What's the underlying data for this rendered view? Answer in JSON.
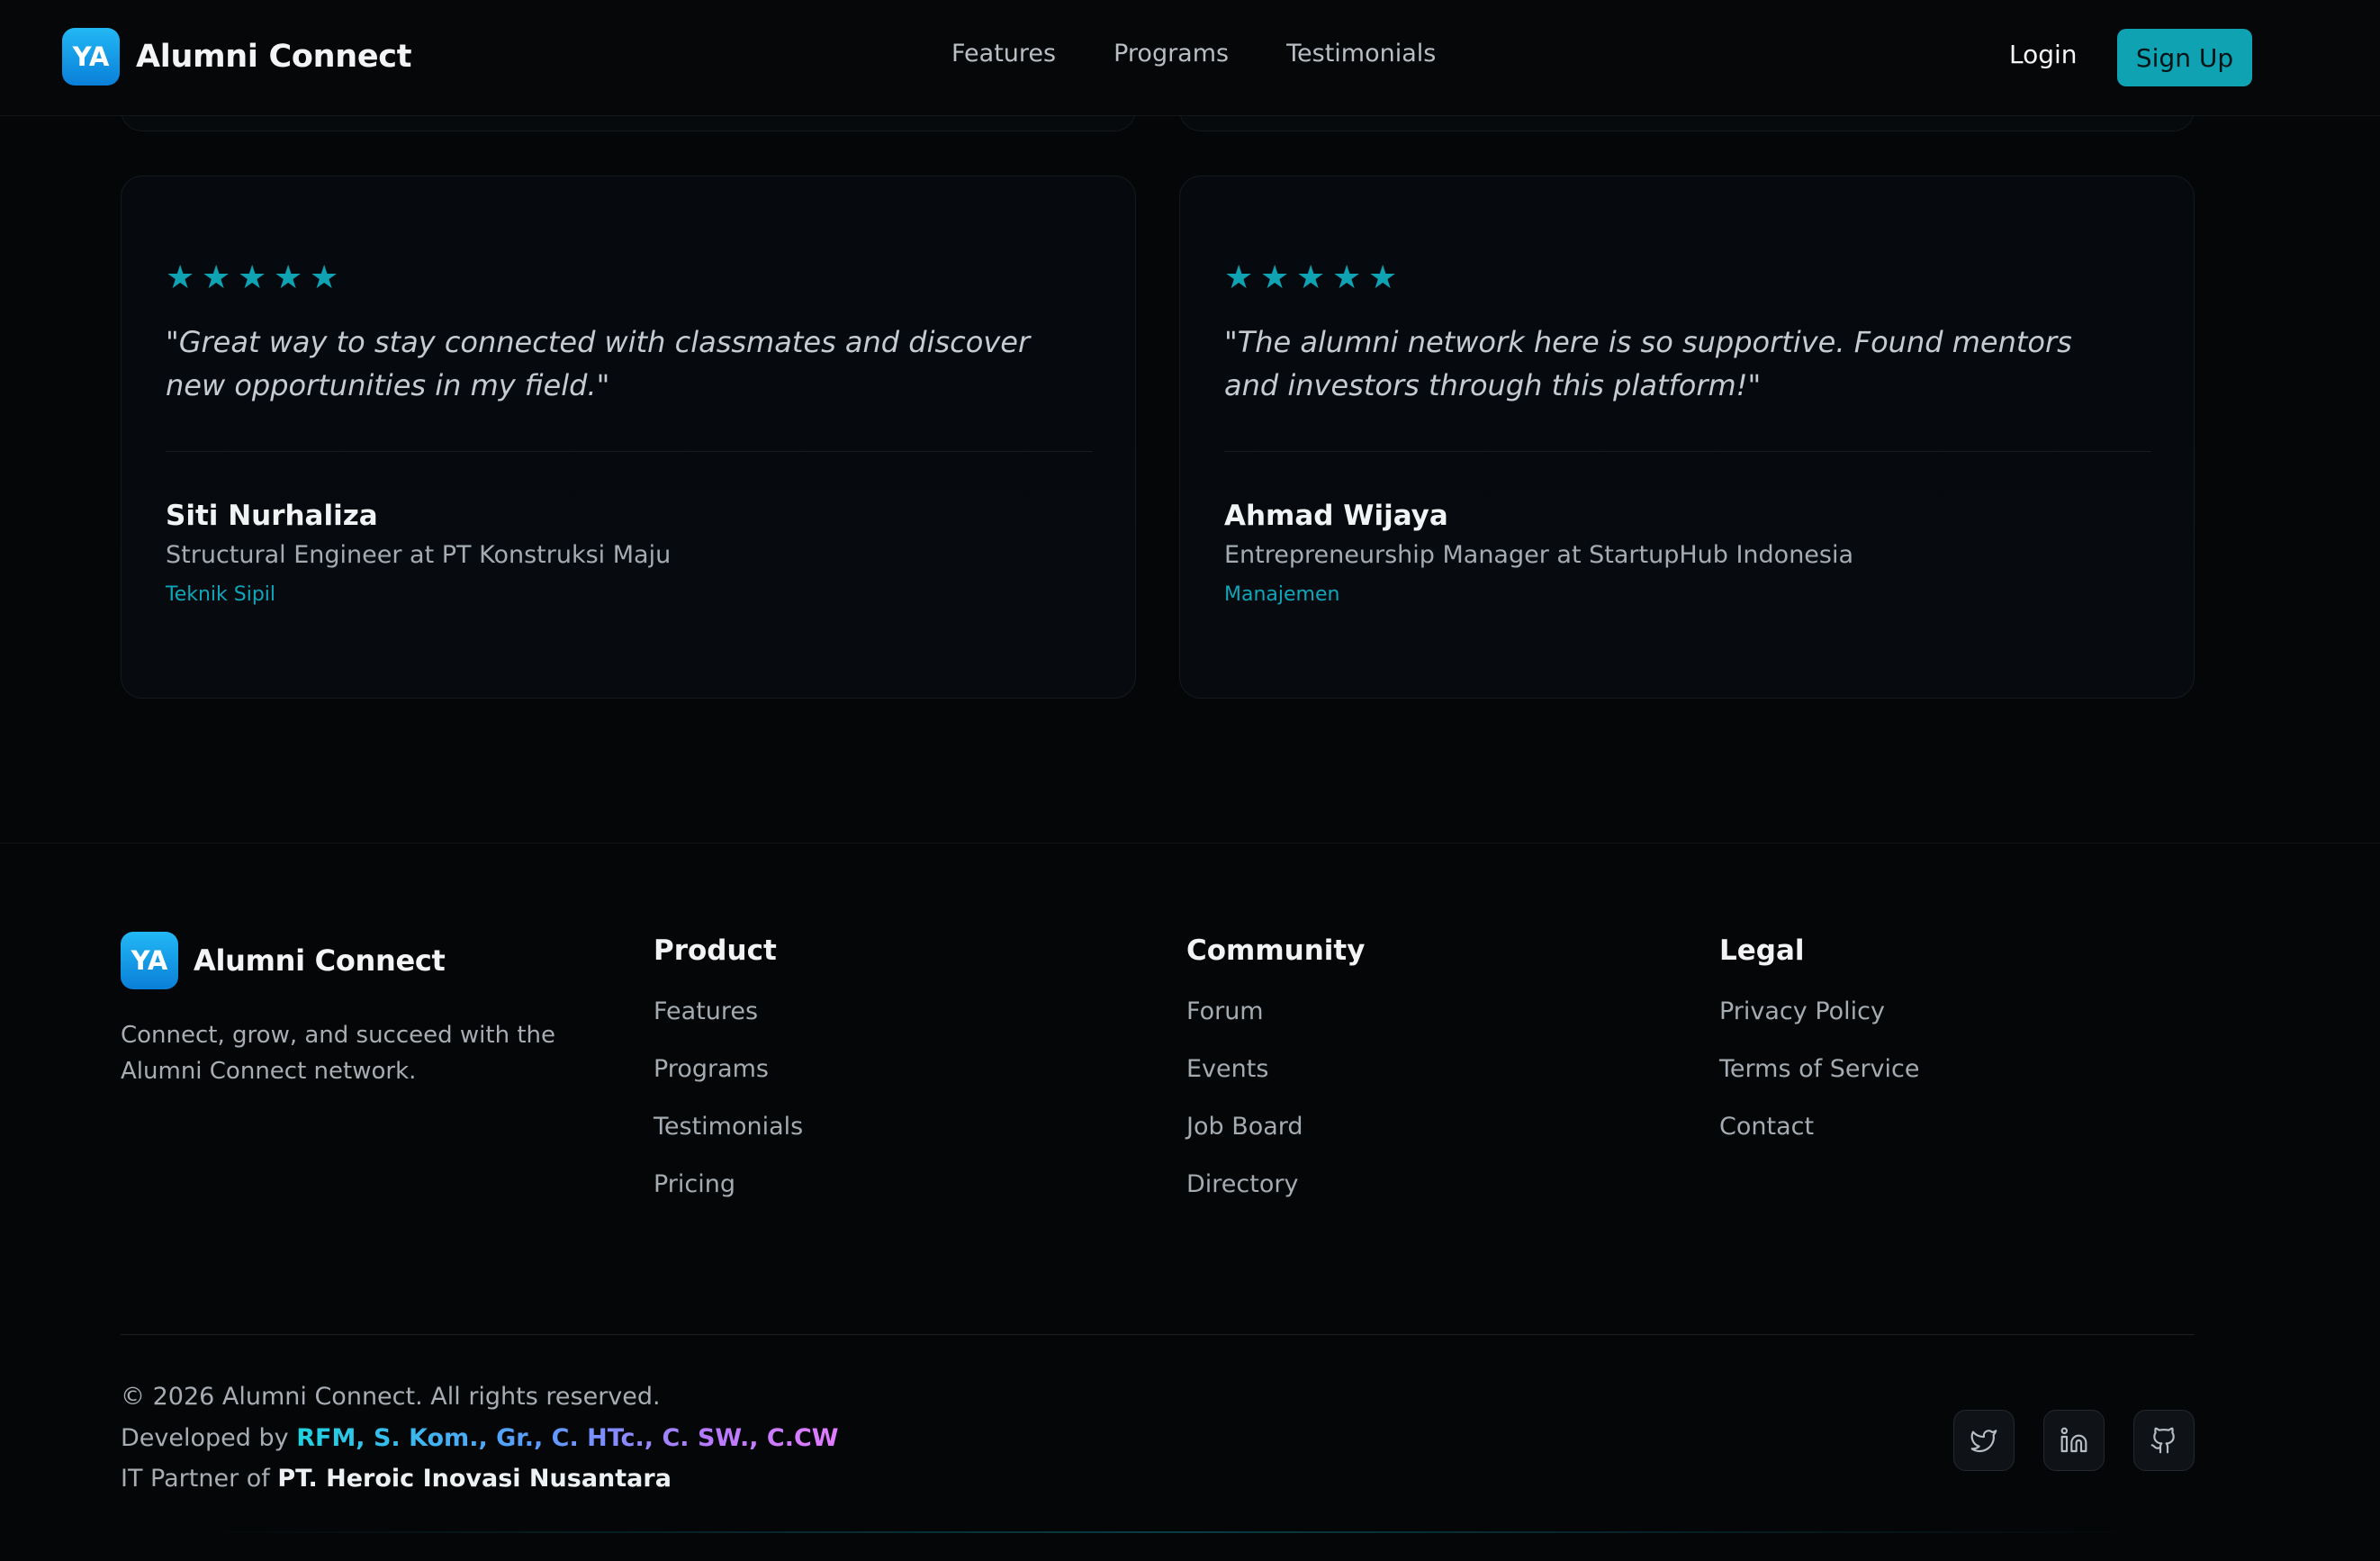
{
  "header": {
    "logo_initials": "YA",
    "brand_name": "Alumni Connect",
    "nav": [
      "Features",
      "Programs",
      "Testimonials"
    ],
    "login_label": "Login",
    "signup_label": "Sign Up"
  },
  "testimonials": [
    {
      "rating": 5,
      "quote": "\"Great way to stay connected with classmates and discover new opportunities in my field.\"",
      "name": "Siti Nurhaliza",
      "role": "Structural Engineer at PT Konstruksi Maju",
      "department": "Teknik Sipil"
    },
    {
      "rating": 5,
      "quote": "\"The alumni network here is so supportive. Found mentors and investors through this platform!\"",
      "name": "Ahmad Wijaya",
      "role": "Entrepreneurship Manager at StartupHub Indonesia",
      "department": "Manajemen"
    }
  ],
  "footer": {
    "logo_initials": "YA",
    "brand_name": "Alumni Connect",
    "tagline": "Connect, grow, and succeed with the Alumni Connect network.",
    "columns": [
      {
        "title": "Product",
        "links": [
          "Features",
          "Programs",
          "Testimonials",
          "Pricing"
        ]
      },
      {
        "title": "Community",
        "links": [
          "Forum",
          "Events",
          "Job Board",
          "Directory"
        ]
      },
      {
        "title": "Legal",
        "links": [
          "Privacy Policy",
          "Terms of Service",
          "Contact"
        ]
      }
    ],
    "copyright": "© 2026 Alumni Connect. All rights reserved.",
    "developed_prefix": "Developed by",
    "developer": "RFM, S. Kom., Gr., C. HTc., C. SW., C.CW",
    "partner_prefix": "IT Partner of",
    "partner": "PT. Heroic Inovasi Nusantara",
    "socials": [
      "twitter-icon",
      "linkedin-icon",
      "github-icon"
    ]
  },
  "colors": {
    "accent": "#0ea2b3",
    "background": "#050608",
    "star": "#0ea2b3"
  }
}
